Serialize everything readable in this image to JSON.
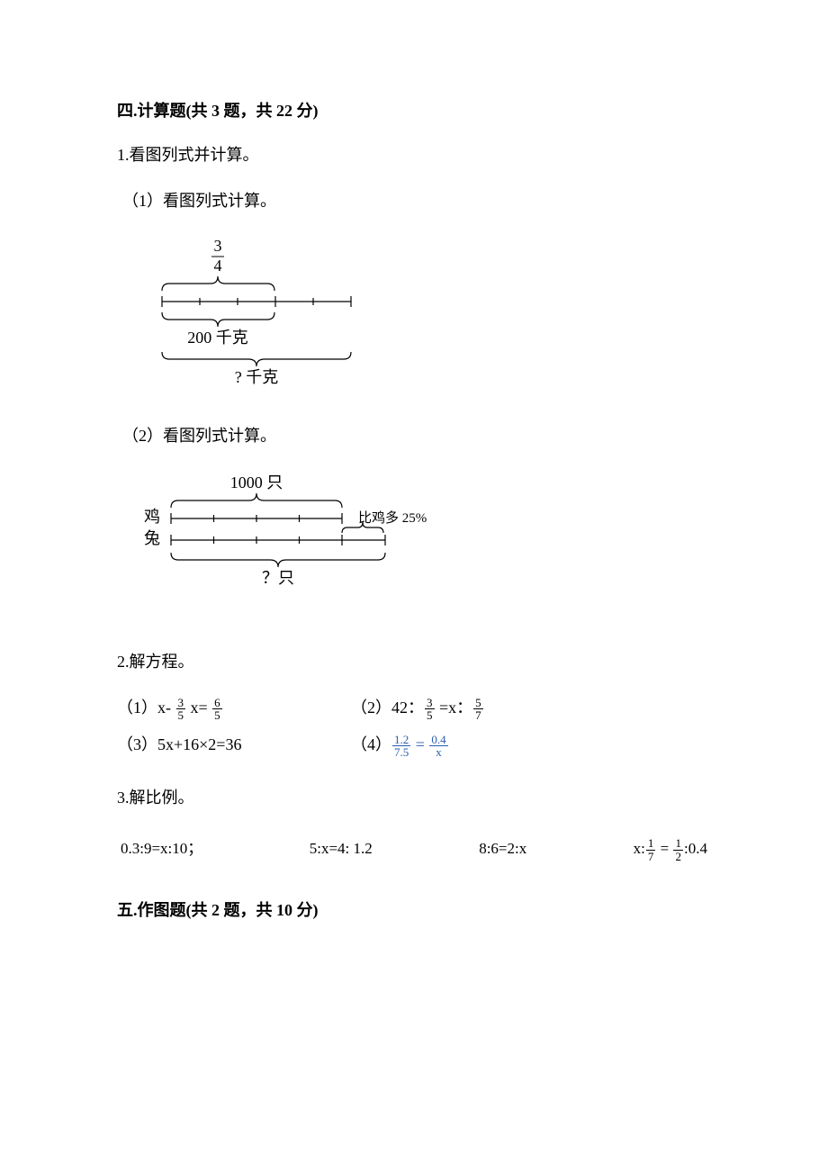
{
  "s4": {
    "title": "四.计算题(共 3 题，共 22 分)",
    "q1": {
      "stem": "1.看图列式并计算。",
      "p1": {
        "label": "（1）看图列式计算。",
        "frac_num": "3",
        "frac_den": "4",
        "mid": "200 千克",
        "bottom": "? 千克"
      },
      "p2": {
        "label": "（2）看图列式计算。",
        "top": "1000 只",
        "left1": "鸡",
        "left2": "兔",
        "right": "比鸡多 25%",
        "bottom": "？只"
      }
    },
    "q2": {
      "stem": "2.解方程。",
      "e1": {
        "pre": "（1）x- ",
        "n": "3",
        "d": "5",
        "mid": " x= ",
        "n2": "6",
        "d2": "5"
      },
      "e2": {
        "pre": "（2）42：",
        "n": "3",
        "d": "5",
        "mid": " =x：",
        "n2": "5",
        "d2": "7"
      },
      "e3": {
        "text": "（3）5x+16×2=36"
      },
      "e4": {
        "pre": "（4）",
        "n1": "1.2",
        "d1": "7.5",
        "eq": " = ",
        "n2": "0.4",
        "d2": "x"
      }
    },
    "q3": {
      "stem": "3.解比例。",
      "a": "0.3:9=x:10；",
      "b": "5:x=4: 1.2",
      "c": "8:6=2:x",
      "d": {
        "pre": "x:",
        "n1": "1",
        "d1": "7",
        "mid": " = ",
        "n2": "1",
        "d2": "2",
        "post": ":0.4"
      }
    }
  },
  "s5": {
    "title": "五.作图题(共 2 题，共 10 分)"
  }
}
